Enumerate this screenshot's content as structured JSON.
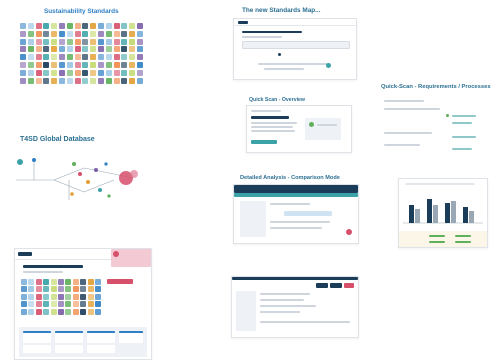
{
  "slides": {
    "sustainability_standards": {
      "title": "Sustainability Standards"
    },
    "t4sd_database": {
      "title": "T4SD Global Database"
    },
    "new_standards_map": {
      "title": "The new Standards Map..."
    },
    "quick_scan_overview": {
      "title": "Quick Scan - Overview"
    },
    "detailed_analysis": {
      "title": "Detailed Analysis - Comparison Mode"
    },
    "quick_scan_requirements": {
      "title": "Quick-Scan - Requirements / Processes"
    }
  },
  "colors": {
    "title_blue": "#2f7fc4",
    "title_teal": "#2b6f92",
    "brand_navy": "#1c3d5a",
    "accent_teal": "#3ba3a8",
    "accent_pink": "#d64f6b",
    "accent_green": "#5fb05a",
    "panel_gray": "#eef1f5"
  }
}
